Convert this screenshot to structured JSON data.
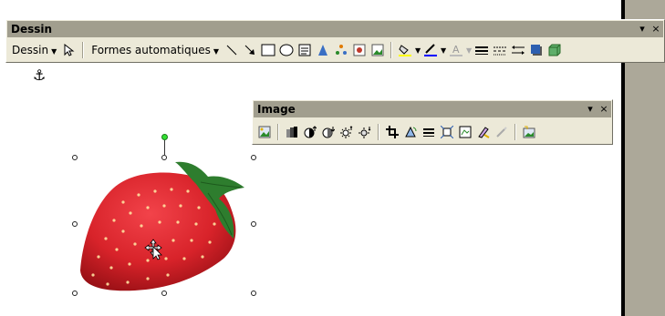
{
  "dessin_toolbar": {
    "title": "Dessin",
    "menu_dessin": "Dessin",
    "menu_formes": "Formes automatiques"
  },
  "image_toolbar": {
    "title": "Image"
  },
  "titlebar_buttons": {
    "options": "▾",
    "close": "×"
  },
  "colors": {
    "toolbar_bg": "#ECE9D8",
    "titlebar_bg": "#A19E8E",
    "strawberry_red": "#D8232A",
    "leaf_green": "#2E7D2E",
    "handle_green": "#33E033"
  },
  "icons": {
    "dessin": [
      "pointer-icon",
      "line-icon",
      "arrow-icon",
      "rectangle-icon",
      "oval-icon",
      "textbox-icon",
      "wordart-icon",
      "diagram-icon",
      "clipart-icon",
      "insert-picture-icon",
      "fill-color-icon",
      "line-color-icon",
      "font-color-icon",
      "line-style-icon",
      "dash-style-icon",
      "arrow-style-icon",
      "shadow-icon",
      "3d-icon"
    ],
    "image": [
      "insert-image-icon",
      "color-icon",
      "more-contrast-icon",
      "less-contrast-icon",
      "more-brightness-icon",
      "less-brightness-icon",
      "crop-icon",
      "rotate-left-icon",
      "line-style-icon",
      "compress-icon",
      "text-wrap-icon",
      "format-picture-icon",
      "set-transparent-color-icon",
      "reset-picture-icon"
    ]
  }
}
